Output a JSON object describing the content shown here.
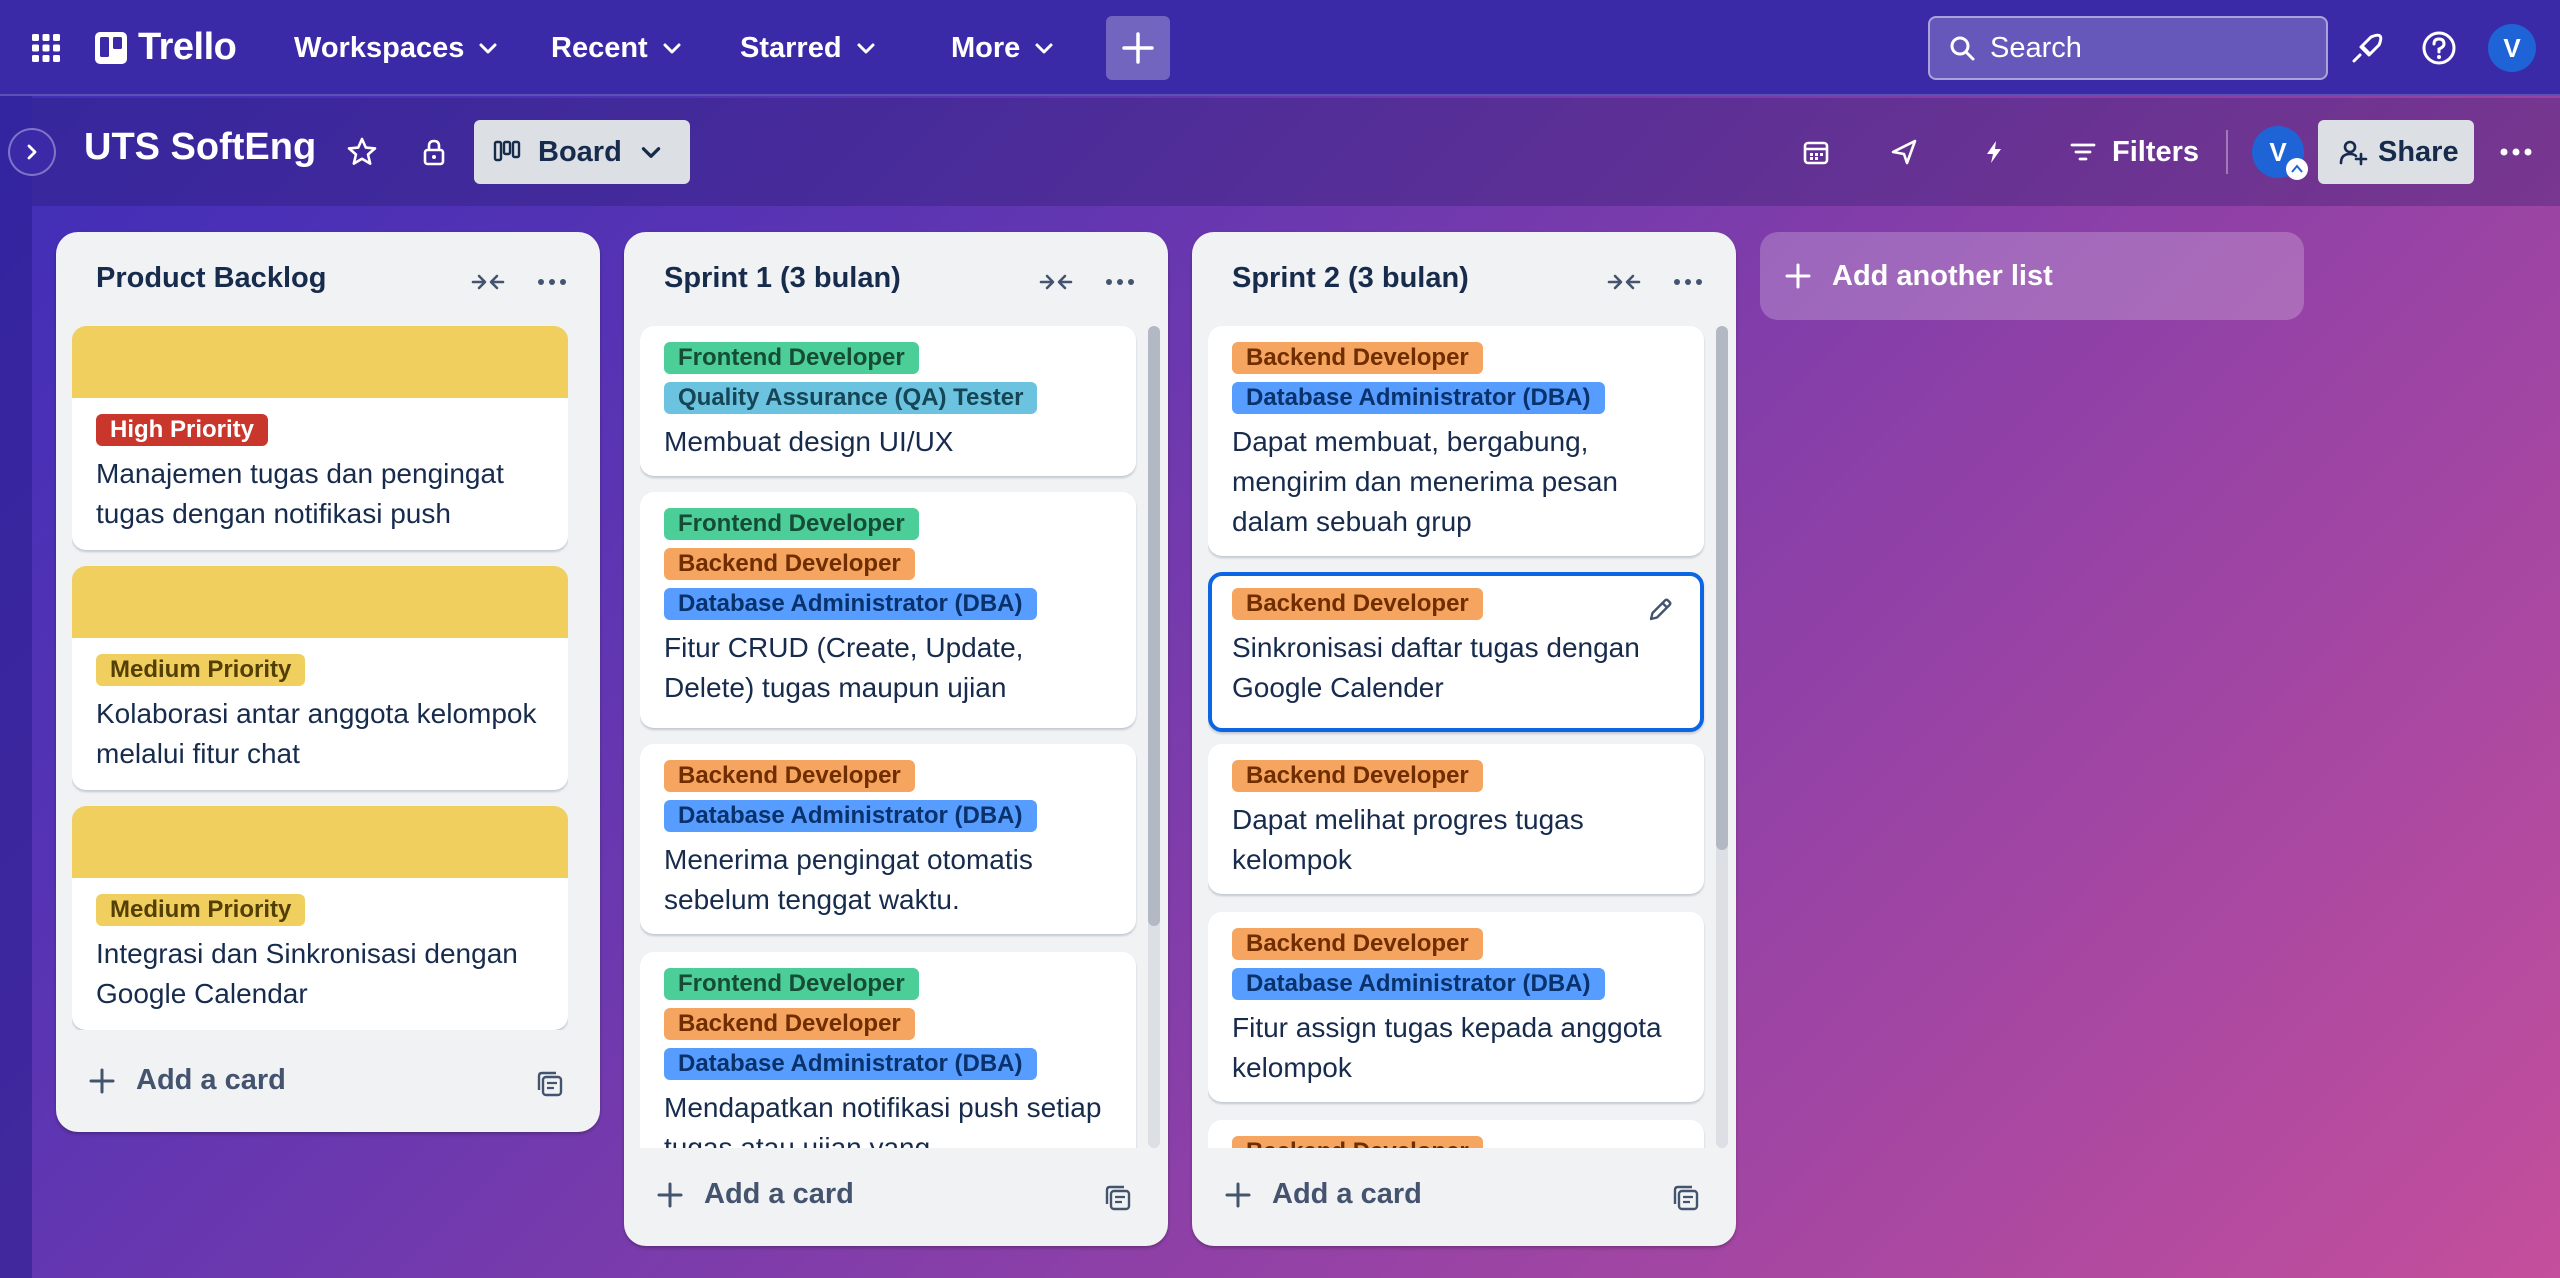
{
  "nav": {
    "logo": "Trello",
    "workspaces": "Workspaces",
    "recent": "Recent",
    "starred": "Starred",
    "more": "More",
    "search_placeholder": "Search",
    "avatar_initial": "V"
  },
  "board": {
    "title": "UTS SoftEng",
    "view": "Board",
    "filters": "Filters",
    "member_initial": "V",
    "share": "Share"
  },
  "lists": [
    {
      "title": "Product Backlog",
      "add_card": "Add a card",
      "cards": [
        {
          "cover": true,
          "labels": [
            "High Priority"
          ],
          "title": "Manajemen tugas dan pengingat tugas dengan notifikasi push"
        },
        {
          "cover": true,
          "labels": [
            "Medium Priority"
          ],
          "title": "Kolaborasi antar anggota kelompok melalui fitur chat"
        },
        {
          "cover": true,
          "labels": [
            "Medium Priority"
          ],
          "title": "Integrasi dan Sinkronisasi dengan Google Calendar"
        }
      ]
    },
    {
      "title": "Sprint 1 (3 bulan)",
      "add_card": "Add a card",
      "cards": [
        {
          "labels": [
            "Frontend Developer",
            "Quality Assurance (QA) Tester"
          ],
          "title": "Membuat design UI/UX"
        },
        {
          "labels": [
            "Frontend Developer",
            "Backend Developer",
            "Database Administrator (DBA)"
          ],
          "title": "Fitur CRUD (Create, Update, Delete) tugas maupun ujian"
        },
        {
          "labels": [
            "Backend Developer",
            "Database Administrator (DBA)"
          ],
          "title": "Menerima pengingat otomatis sebelum tenggat waktu."
        },
        {
          "labels": [
            "Frontend Developer",
            "Backend Developer",
            "Database Administrator (DBA)"
          ],
          "title": "Mendapatkan notifikasi push setiap tugas atau ujian yang"
        }
      ]
    },
    {
      "title": "Sprint 2 (3 bulan)",
      "add_card": "Add a card",
      "cards": [
        {
          "labels": [
            "Backend Developer",
            "Database Administrator (DBA)"
          ],
          "title": "Dapat membuat, bergabung, mengirim dan menerima pesan dalam sebuah grup"
        },
        {
          "labels": [
            "Backend Developer"
          ],
          "title": "Sinkronisasi daftar tugas dengan Google Calender",
          "selected": true
        },
        {
          "labels": [
            "Backend Developer"
          ],
          "title": "Dapat melihat progres tugas kelompok"
        },
        {
          "labels": [
            "Backend Developer",
            "Database Administrator (DBA)"
          ],
          "title": "Fitur assign tugas kepada anggota kelompok"
        },
        {
          "labels": [
            "Backend Developer"
          ],
          "title": ""
        }
      ]
    }
  ],
  "add_list": "Add another list",
  "label_colors": {
    "Frontend Developer": "#4bce97",
    "Quality Assurance (QA) Tester": "#6cc3e0",
    "Backend Developer": "#f5a55f",
    "Database Administrator (DBA)": "#579dff",
    "High Priority": "#c9372c",
    "Medium Priority": "#f0cf5f"
  }
}
